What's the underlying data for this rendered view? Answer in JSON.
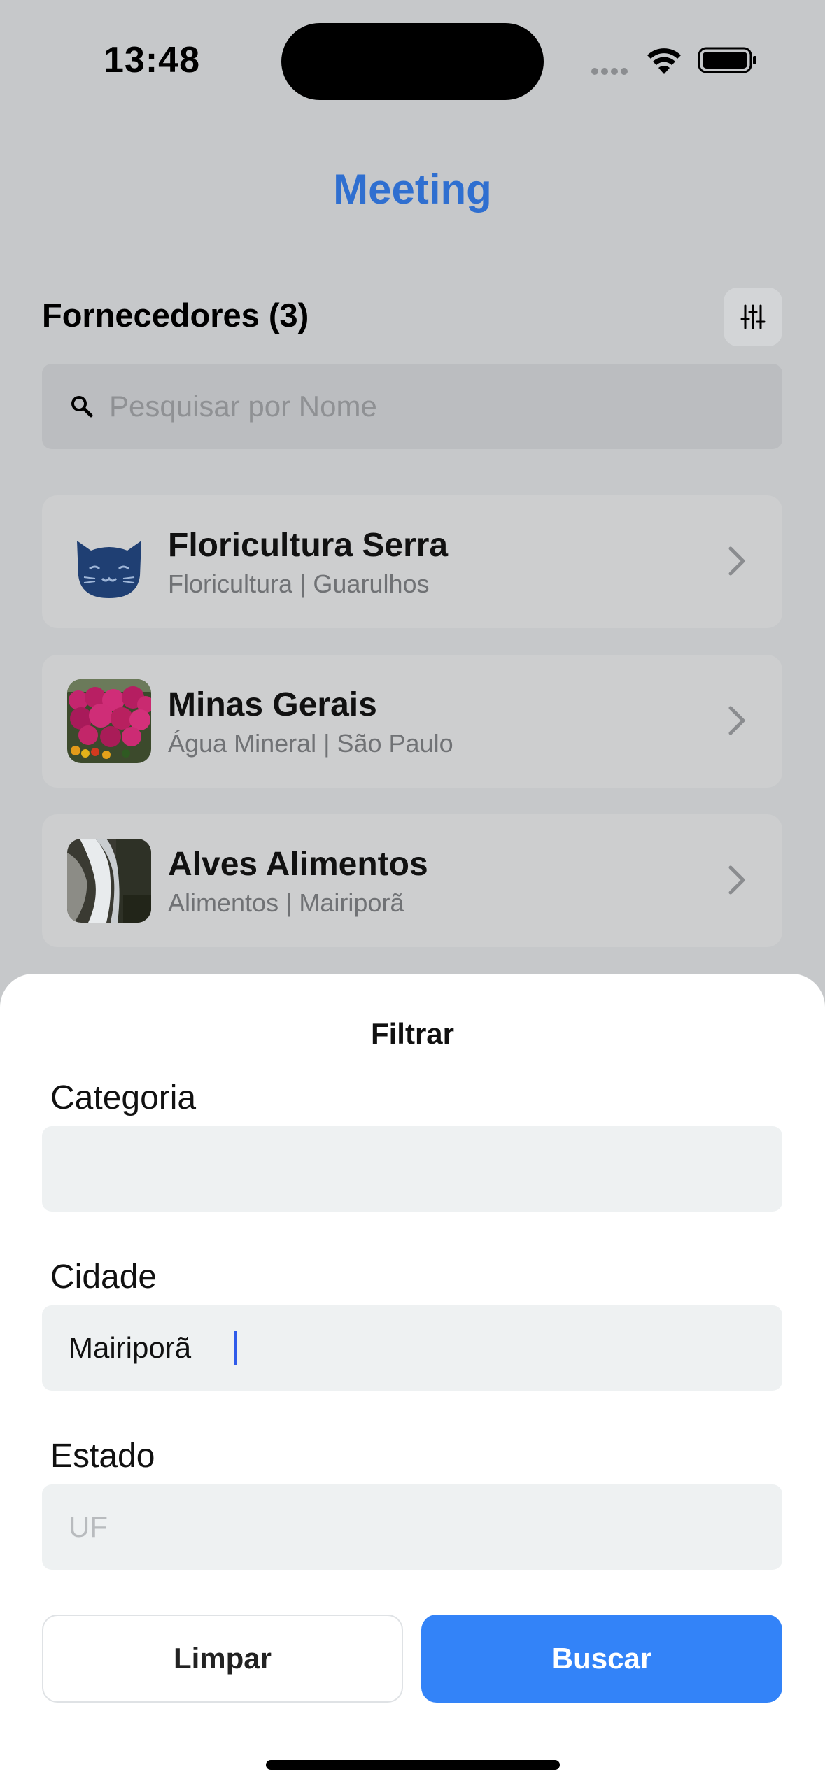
{
  "status_bar": {
    "time": "13:48"
  },
  "header": {
    "app_title": "Meeting"
  },
  "list": {
    "title": "Fornecedores (3)",
    "filter_icon": "sliders-icon",
    "search_placeholder": "Pesquisar por Nome",
    "items": [
      {
        "name": "Floricultura Serra",
        "subtitle": "Floricultura | Guarulhos",
        "thumb": "cat-logo-icon"
      },
      {
        "name": "Minas Gerais",
        "subtitle": "Água Mineral | São Paulo",
        "thumb": "flowers-photo"
      },
      {
        "name": "Alves Alimentos",
        "subtitle": "Alimentos | Mairiporã",
        "thumb": "waterfall-photo"
      }
    ]
  },
  "filter_sheet": {
    "title": "Filtrar",
    "categoria": {
      "label": "Categoria",
      "value": "",
      "placeholder": ""
    },
    "cidade": {
      "label": "Cidade",
      "value": "Mairiporã",
      "placeholder": ""
    },
    "estado": {
      "label": "Estado",
      "value": "",
      "placeholder": "UF"
    },
    "clear_label": "Limpar",
    "search_label": "Buscar"
  },
  "colors": {
    "accent": "#3383f8",
    "title_blue": "#2f6fd0",
    "dim_background": "#c6c8ca"
  }
}
